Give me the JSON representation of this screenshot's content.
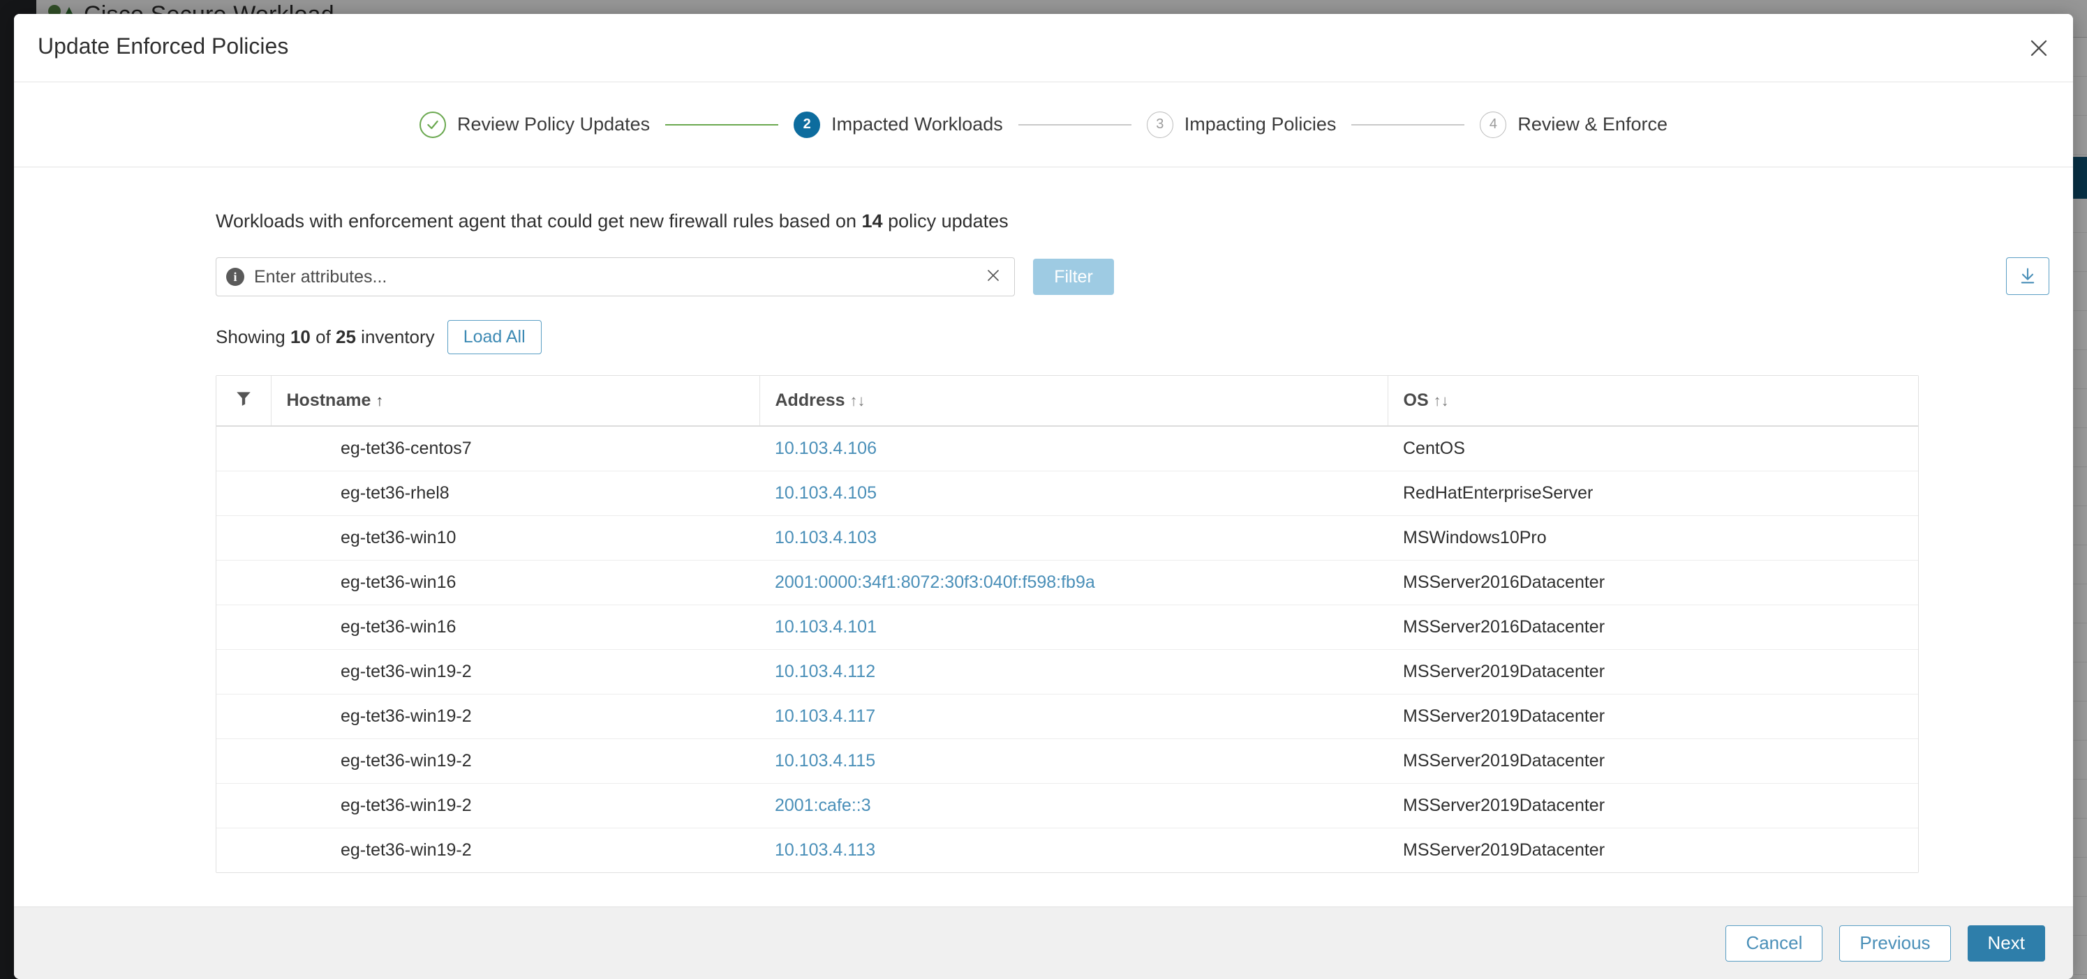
{
  "background_app": {
    "title": "Cisco Secure Workload"
  },
  "modal": {
    "title": "Update Enforced Policies",
    "close_icon": "close-icon"
  },
  "stepper": {
    "steps": [
      {
        "number": "1",
        "label": "Review Policy Updates",
        "state": "done"
      },
      {
        "number": "2",
        "label": "Impacted Workloads",
        "state": "active"
      },
      {
        "number": "3",
        "label": "Impacting Policies",
        "state": "todo"
      },
      {
        "number": "4",
        "label": "Review & Enforce",
        "state": "todo"
      }
    ]
  },
  "content": {
    "description_prefix": "Workloads with enforcement agent that could get new firewall rules based on ",
    "description_count": "14",
    "description_suffix": " policy updates",
    "search": {
      "placeholder": "Enter attributes...",
      "value": "",
      "info_icon": "info-icon",
      "clear_icon": "clear-icon"
    },
    "filter_button": "Filter",
    "download_icon": "download-icon",
    "showing": {
      "prefix": "Showing ",
      "shown": "10",
      "middle": " of ",
      "total": "25",
      "suffix": " inventory"
    },
    "load_all_button": "Load All"
  },
  "table": {
    "filter_icon": "funnel-icon",
    "columns": [
      {
        "label": "Hostname",
        "sort": "↑",
        "sorted": true
      },
      {
        "label": "Address",
        "sort": "↑↓",
        "sorted": false
      },
      {
        "label": "OS",
        "sort": "↑↓",
        "sorted": false
      }
    ],
    "rows": [
      {
        "hostname": "eg-tet36-centos7",
        "address": "10.103.4.106",
        "os": "CentOS"
      },
      {
        "hostname": "eg-tet36-rhel8",
        "address": "10.103.4.105",
        "os": "RedHatEnterpriseServer"
      },
      {
        "hostname": "eg-tet36-win10",
        "address": "10.103.4.103",
        "os": "MSWindows10Pro"
      },
      {
        "hostname": "eg-tet36-win16",
        "address": "2001:0000:34f1:8072:30f3:040f:f598:fb9a",
        "os": "MSServer2016Datacenter"
      },
      {
        "hostname": "eg-tet36-win16",
        "address": "10.103.4.101",
        "os": "MSServer2016Datacenter"
      },
      {
        "hostname": "eg-tet36-win19-2",
        "address": "10.103.4.112",
        "os": "MSServer2019Datacenter"
      },
      {
        "hostname": "eg-tet36-win19-2",
        "address": "10.103.4.117",
        "os": "MSServer2019Datacenter"
      },
      {
        "hostname": "eg-tet36-win19-2",
        "address": "10.103.4.115",
        "os": "MSServer2019Datacenter"
      },
      {
        "hostname": "eg-tet36-win19-2",
        "address": "2001:cafe::3",
        "os": "MSServer2019Datacenter"
      },
      {
        "hostname": "eg-tet36-win19-2",
        "address": "10.103.4.113",
        "os": "MSServer2019Datacenter"
      }
    ]
  },
  "footer": {
    "cancel": "Cancel",
    "previous": "Previous",
    "next": "Next"
  },
  "colors": {
    "accent_blue": "#2e7eaa",
    "link_blue": "#4a8fb8",
    "step_done_green": "#6aa84f",
    "step_active_blue": "#0d6c9e",
    "filter_disabled": "#9ecbe3"
  }
}
